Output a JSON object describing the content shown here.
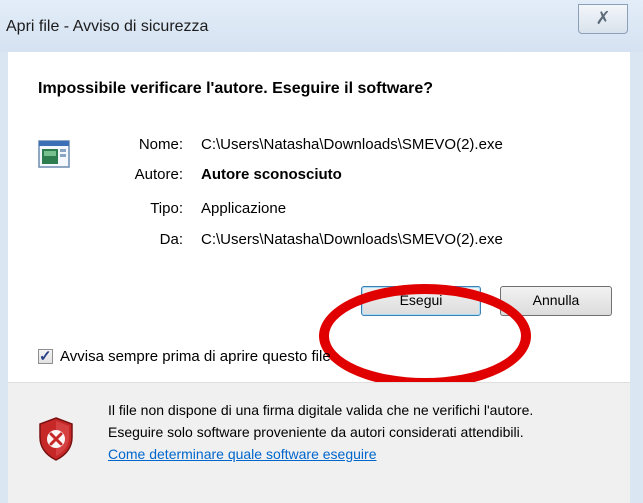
{
  "window": {
    "title": "Apri file - Avviso di sicurezza",
    "close_glyph": "✗"
  },
  "dialog": {
    "headline": "Impossibile verificare l'autore. Eseguire il software?",
    "app_icon": "application-window-icon",
    "fields": [
      {
        "label": "Nome:",
        "value": "C:\\Users\\Natasha\\Downloads\\SMEVO(2).exe",
        "bold": false
      },
      {
        "label": "Autore:",
        "value": "Autore sconosciuto",
        "bold": true
      },
      {
        "label": "Tipo:",
        "value": "Applicazione",
        "bold": false
      },
      {
        "label": "Da:",
        "value": "C:\\Users\\Natasha\\Downloads\\SMEVO(2).exe",
        "bold": false
      }
    ],
    "buttons": {
      "run": "Esegui",
      "cancel": "Annulla"
    },
    "annotation_color": "#e00000",
    "checkbox": {
      "checked": true,
      "label": "Avvisa sempre prima di aprire questo file"
    }
  },
  "footer": {
    "shield_icon": "security-shield-icon",
    "line1": "Il file non dispone di una firma digitale valida che ne verifichi l'autore.",
    "line2": "Eseguire solo software proveniente da autori considerati attendibili.",
    "link": "Come determinare quale software eseguire"
  }
}
